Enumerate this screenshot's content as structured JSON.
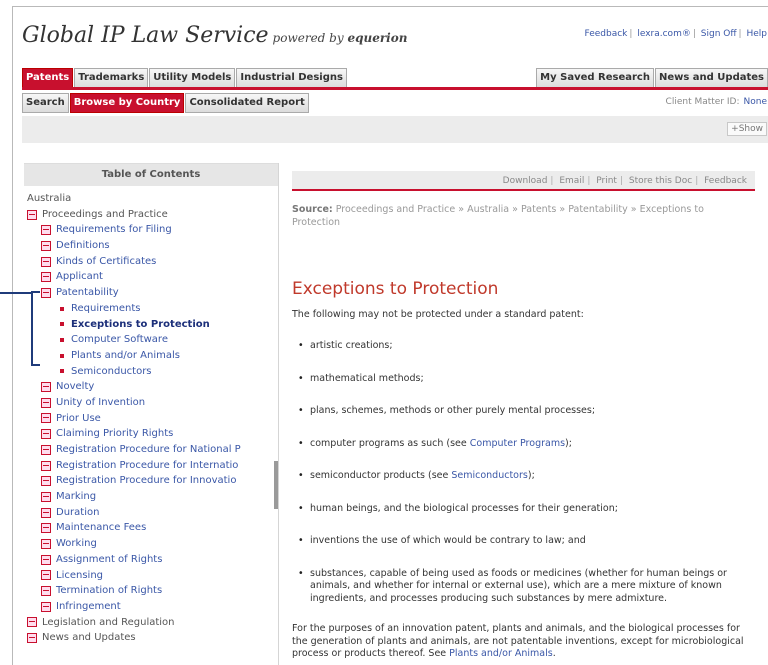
{
  "header": {
    "brand": "Global IP Law Service",
    "powered_by": "powered by",
    "partner": "equerion",
    "links": [
      "Feedback",
      "lexra.com®",
      "Sign Off",
      "Help"
    ]
  },
  "tabs_primary": {
    "left": [
      "Patents",
      "Trademarks",
      "Utility Models",
      "Industrial Designs"
    ],
    "right": [
      "My Saved Research",
      "News and Updates"
    ],
    "active": "Patents"
  },
  "tabs_secondary": {
    "items": [
      "Search",
      "Browse by Country",
      "Consolidated Report"
    ],
    "active": "Browse by Country"
  },
  "client": {
    "label": "Client Matter ID:",
    "value": "None"
  },
  "show_button": "+Show",
  "toc": {
    "heading": "Table of Contents",
    "items": [
      {
        "label": "Australia",
        "level": 0,
        "icon": "none",
        "style": "plain"
      },
      {
        "label": "Proceedings and Practice",
        "level": 1,
        "icon": "box",
        "style": "plain"
      },
      {
        "label": "Requirements for Filing",
        "level": 2,
        "icon": "box",
        "style": "link"
      },
      {
        "label": "Definitions",
        "level": 2,
        "icon": "box",
        "style": "link"
      },
      {
        "label": "Kinds of Certificates",
        "level": 2,
        "icon": "box",
        "style": "link"
      },
      {
        "label": "Applicant",
        "level": 2,
        "icon": "box",
        "style": "link"
      },
      {
        "label": "Patentability",
        "level": 2,
        "icon": "box",
        "style": "link"
      },
      {
        "label": "Requirements",
        "level": 3,
        "icon": "dot",
        "style": "link"
      },
      {
        "label": "Exceptions to Protection",
        "level": 3,
        "icon": "dot",
        "style": "cur"
      },
      {
        "label": "Computer Software",
        "level": 3,
        "icon": "dot",
        "style": "link"
      },
      {
        "label": "Plants and/or Animals",
        "level": 3,
        "icon": "dot",
        "style": "link"
      },
      {
        "label": "Semiconductors",
        "level": 3,
        "icon": "dot",
        "style": "link"
      },
      {
        "label": "Novelty",
        "level": 2,
        "icon": "box",
        "style": "link"
      },
      {
        "label": "Unity of Invention",
        "level": 2,
        "icon": "box",
        "style": "link"
      },
      {
        "label": "Prior Use",
        "level": 2,
        "icon": "box",
        "style": "link"
      },
      {
        "label": "Claiming Priority Rights",
        "level": 2,
        "icon": "box",
        "style": "link"
      },
      {
        "label": "Registration Procedure for National P",
        "level": 2,
        "icon": "box",
        "style": "link"
      },
      {
        "label": "Registration Procedure for Internatio",
        "level": 2,
        "icon": "box",
        "style": "link"
      },
      {
        "label": "Registration Procedure for Innovatio",
        "level": 2,
        "icon": "box",
        "style": "link"
      },
      {
        "label": "Marking",
        "level": 2,
        "icon": "box",
        "style": "link"
      },
      {
        "label": "Duration",
        "level": 2,
        "icon": "box",
        "style": "link"
      },
      {
        "label": "Maintenance Fees",
        "level": 2,
        "icon": "box",
        "style": "link"
      },
      {
        "label": "Working",
        "level": 2,
        "icon": "box",
        "style": "link"
      },
      {
        "label": "Assignment of Rights",
        "level": 2,
        "icon": "box",
        "style": "link"
      },
      {
        "label": "Licensing",
        "level": 2,
        "icon": "box",
        "style": "link"
      },
      {
        "label": "Termination of Rights",
        "level": 2,
        "icon": "box",
        "style": "link"
      },
      {
        "label": "Infringement",
        "level": 2,
        "icon": "box",
        "style": "link"
      },
      {
        "label": "Legislation and Regulation",
        "level": 1,
        "icon": "box",
        "style": "plain"
      },
      {
        "label": "News and Updates",
        "level": 1,
        "icon": "box",
        "style": "plain"
      }
    ]
  },
  "doc_tools": [
    "Download",
    "Email",
    "Print",
    "Store this Doc",
    "Feedback"
  ],
  "source": {
    "label": "Source:",
    "path": "Proceedings and Practice » Australia » Patents » Patentability » Exceptions to Protection"
  },
  "article": {
    "title": "Exceptions to Protection",
    "intro": "The following may not be protected under a standard patent:",
    "list": [
      {
        "text": "artistic creations;"
      },
      {
        "text": "mathematical methods;"
      },
      {
        "text": "plans, schemes, methods or other purely mental processes;"
      },
      {
        "pre": "computer programs as such (see ",
        "link": "Computer Programs",
        "post": ");"
      },
      {
        "pre": "semiconductor products (see ",
        "link": "Semiconductors",
        "post": ");"
      },
      {
        "text": "human beings, and the biological processes for their generation;"
      },
      {
        "text": "inventions the use of which would be contrary to law; and"
      },
      {
        "text": "substances, capable of being used as foods or medicines (whether for human beings or animals, and whether for internal or external use), which are a mere mixture of known ingredients, and processes producing such substances by mere admixture."
      }
    ],
    "outro_pre": "For the purposes of an innovation patent, plants and animals, and the biological processes for the generation of plants and animals, are not patentable inventions, except for microbiological process or products thereof. See ",
    "outro_link": "Plants and/or Animals",
    "outro_post": "."
  },
  "colors": {
    "accent": "#c8102e",
    "link": "#3a57a7",
    "callout": "#1f3b7a"
  }
}
